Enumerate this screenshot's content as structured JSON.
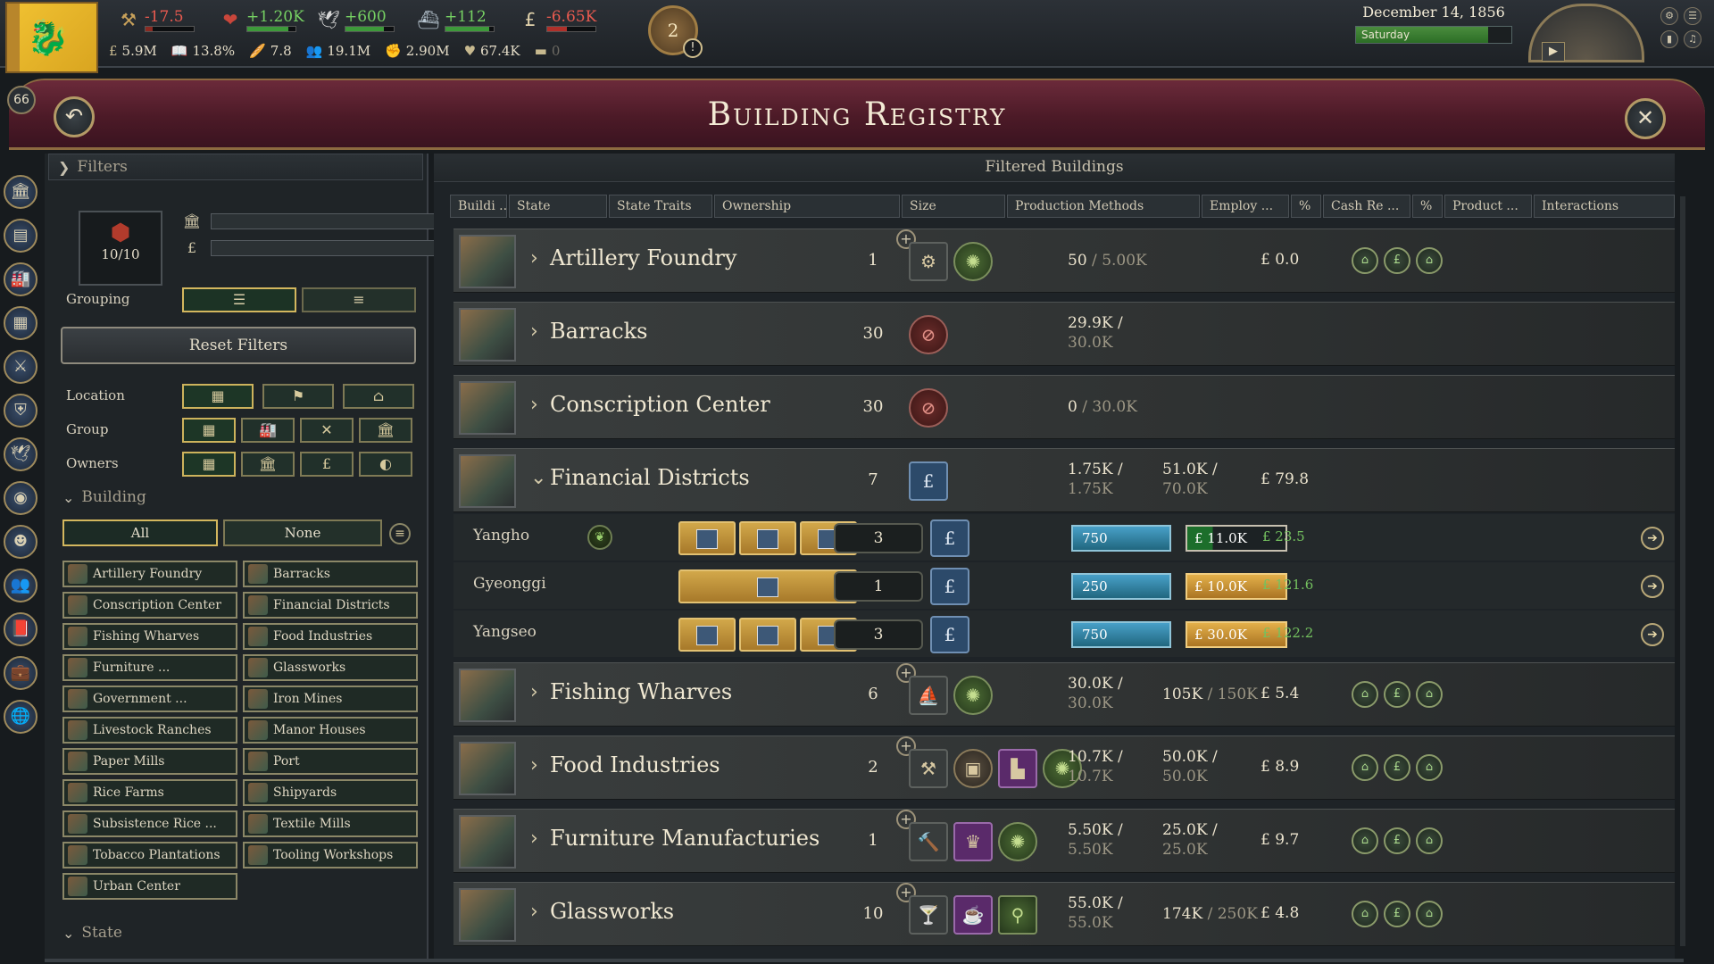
{
  "country_rank": "66",
  "resources": [
    {
      "name": "Authority",
      "icon": "authority-icon",
      "value": "-17.5",
      "tone": "neg"
    },
    {
      "name": "Influence",
      "icon": "influence-icon",
      "value": "+1.20K",
      "tone": "pos"
    },
    {
      "name": "Bureaucracy",
      "icon": "bureaucracy-icon",
      "value": "+600",
      "tone": "pos"
    },
    {
      "name": "Naval",
      "icon": "ship-icon",
      "value": "+112",
      "tone": "pos"
    },
    {
      "name": "Treasury",
      "icon": "pound-icon",
      "value": "-6.65K",
      "tone": "neg"
    }
  ],
  "stats": [
    {
      "icon": "gdp-icon",
      "glyph": "£",
      "value": "5.9M"
    },
    {
      "icon": "literacy-icon",
      "glyph": "📖",
      "value": "13.8%"
    },
    {
      "icon": "sol-icon",
      "glyph": "🥖",
      "value": "7.8"
    },
    {
      "icon": "population-icon",
      "glyph": "👥",
      "value": "19.1M"
    },
    {
      "icon": "workforce-icon",
      "glyph": "✊",
      "value": "2.90M"
    },
    {
      "icon": "loyalty-icon",
      "glyph": "♥",
      "value": "67.4K"
    },
    {
      "icon": "debt-icon",
      "glyph": "▬",
      "value": "0"
    }
  ],
  "journal_count": "2",
  "date": "December 14, 1856",
  "weekday": "Saturday",
  "title": "Building Registry",
  "filters": {
    "header": "Filters",
    "counter": "10/10",
    "bar1_value": "0",
    "bar2_value": "0",
    "grouping_label": "Grouping",
    "reset_label": "Reset Filters",
    "location_label": "Location",
    "group_label": "Group",
    "owners_label": "Owners",
    "building_header": "Building",
    "all_label": "All",
    "none_label": "None",
    "state_header": "State",
    "buildings": [
      "Artillery Foundry",
      "Barracks",
      "Conscription Center",
      "Financial Districts",
      "Fishing Wharves",
      "Food Industries",
      "Furniture ...",
      "Glassworks",
      "Government ...",
      "Iron Mines",
      "Livestock Ranches",
      "Manor Houses",
      "Paper Mills",
      "Port",
      "Rice Farms",
      "Shipyards",
      "Subsistence Rice ...",
      "Textile Mills",
      "Tobacco Plantations",
      "Tooling Workshops",
      "Urban Center"
    ]
  },
  "main": {
    "header": "Filtered Buildings",
    "columns": [
      "Buildi ...",
      "State",
      "State Traits",
      "Ownership",
      "Size",
      "Production Methods",
      "Employ ...",
      "%",
      "Cash Re ...",
      "%",
      "Product ...",
      "Interactions"
    ],
    "rows": [
      {
        "name": "Artillery Foundry",
        "size": "1",
        "emp_a": "50",
        "emp_b": "5.00K",
        "cash_a": "",
        "cash_b": "",
        "prod": "£ 0.0"
      },
      {
        "name": "Barracks",
        "size": "30",
        "emp_a": "29.9K /",
        "emp_b": "30.0K",
        "cash_a": "",
        "cash_b": "",
        "prod": ""
      },
      {
        "name": "Conscription Center",
        "size": "30",
        "emp_a": "0",
        "emp_b": "30.0K",
        "cash_a": "",
        "cash_b": "",
        "prod": ""
      },
      {
        "name": "Financial Districts",
        "size": "7",
        "emp_a": "1.75K /",
        "emp_b": "1.75K",
        "cash_a": "51.0K /",
        "cash_b": "70.0K",
        "prod": "£ 79.8"
      },
      {
        "name": "Fishing Wharves",
        "size": "6",
        "emp_a": "30.0K /",
        "emp_b": "30.0K",
        "cash_a": "105K",
        "cash_b": "150K",
        "prod": "£ 5.4"
      },
      {
        "name": "Food Industries",
        "size": "2",
        "emp_a": "10.7K /",
        "emp_b": "10.7K",
        "cash_a": "50.0K /",
        "cash_b": "50.0K",
        "prod": "£ 8.9"
      },
      {
        "name": "Furniture Manufacturies",
        "size": "1",
        "emp_a": "5.50K /",
        "emp_b": "5.50K",
        "cash_a": "25.0K /",
        "cash_b": "25.0K",
        "prod": "£ 9.7"
      },
      {
        "name": "Glassworks",
        "size": "10",
        "emp_a": "55.0K /",
        "emp_b": "55.0K",
        "cash_a": "174K",
        "cash_b": "250K",
        "prod": "£ 4.8"
      }
    ],
    "sub_rows": [
      {
        "state": "Yangho",
        "size": "3",
        "emp": "750",
        "cash": "£ 11.0K",
        "prod": "£ 23.5"
      },
      {
        "state": "Gyeonggi",
        "size": "1",
        "emp": "250",
        "cash": "£ 10.0K",
        "prod": "£ 121.6"
      },
      {
        "state": "Yangseo",
        "size": "3",
        "emp": "750",
        "cash": "£ 30.0K",
        "prod": "£ 122.2"
      }
    ]
  },
  "colors": {
    "banner": "#5a1f2e",
    "accent_gold": "#d3b75e",
    "employment": "#2f87ac",
    "cash": "#c98f34"
  }
}
